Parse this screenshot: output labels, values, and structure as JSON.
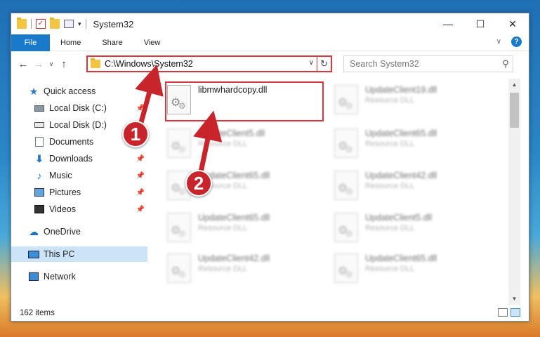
{
  "titlebar": {
    "title": "System32",
    "minimize": "—",
    "maximize": "☐",
    "close": "✕"
  },
  "ribbon": {
    "tabs": [
      "File",
      "Home",
      "Share",
      "View"
    ],
    "help": "?"
  },
  "navbar": {
    "address": "C:\\Windows\\System32",
    "search_placeholder": "Search System32"
  },
  "sidebar": {
    "items": [
      {
        "label": "Quick access",
        "icon": "star-icon",
        "pinned": false
      },
      {
        "label": "Local Disk (C:)",
        "icon": "disk-icon",
        "pinned": true
      },
      {
        "label": "Local Disk (D:)",
        "icon": "disk-icon",
        "pinned": false
      },
      {
        "label": "Documents",
        "icon": "documents-icon",
        "pinned": true
      },
      {
        "label": "Downloads",
        "icon": "downloads-icon",
        "pinned": true
      },
      {
        "label": "Music",
        "icon": "music-icon",
        "pinned": true
      },
      {
        "label": "Pictures",
        "icon": "pictures-icon",
        "pinned": true
      },
      {
        "label": "Videos",
        "icon": "videos-icon",
        "pinned": true
      },
      {
        "label": "OneDrive",
        "icon": "onedrive-icon",
        "pinned": false
      },
      {
        "label": "This PC",
        "icon": "this-pc-icon",
        "pinned": false,
        "selected": true
      },
      {
        "label": "Network",
        "icon": "network-icon",
        "pinned": false
      }
    ]
  },
  "files": [
    {
      "name": "libmwhardcopy.dll",
      "type": ""
    },
    {
      "name": "UpdateClient19.dll",
      "type": "Resource DLL"
    },
    {
      "name": "UpdateClient5.dll",
      "type": "Resource DLL"
    },
    {
      "name": "UpdateClient65.dll",
      "type": "Resource DLL"
    },
    {
      "name": "UpdateClient65.dll",
      "type": "Resource DLL"
    },
    {
      "name": "UpdateClient42.dll",
      "type": "Resource DLL"
    },
    {
      "name": "UpdateClient65.dll",
      "type": "Resource DLL"
    },
    {
      "name": "UpdateClient5.dll",
      "type": "Resource DLL"
    },
    {
      "name": "UpdateClient42.dll",
      "type": "Resource DLL"
    },
    {
      "name": "UpdateClient65.dll",
      "type": "Resource DLL"
    }
  ],
  "status": {
    "item_count": "162 items"
  },
  "annotations": {
    "step1": "1",
    "step2": "2",
    "color": "#c8242b"
  }
}
